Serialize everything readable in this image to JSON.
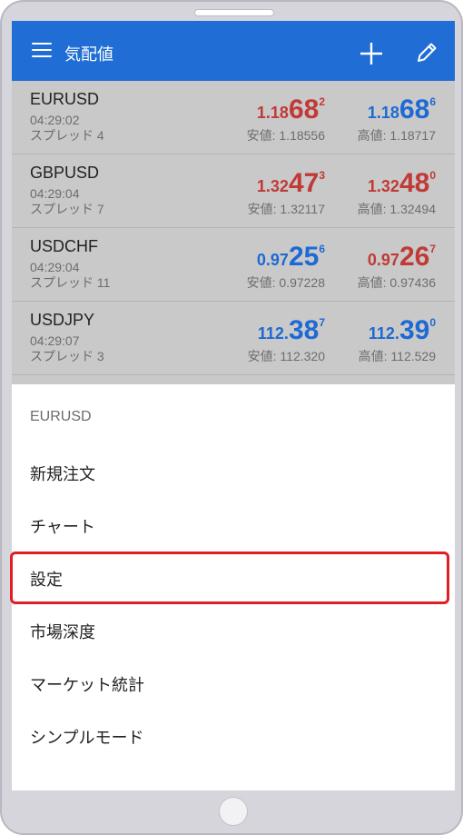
{
  "app": {
    "title": "気配値",
    "menu_icon": "hamburger-menu-icon",
    "add_icon": "plus-icon",
    "edit_icon": "pencil-icon",
    "header_color": "#1f6dd5"
  },
  "quotes": [
    {
      "symbol": "EURUSD",
      "time": "04:29:02",
      "spread": "スプレッド 4",
      "bid": {
        "small": "1.18",
        "big": "68",
        "sup": "2",
        "color": "red"
      },
      "ask": {
        "small": "1.18",
        "big": "68",
        "sup": "6",
        "color": "blue"
      },
      "low": "安値: 1.18556",
      "high": "高値: 1.18717"
    },
    {
      "symbol": "GBPUSD",
      "time": "04:29:04",
      "spread": "スプレッド 7",
      "bid": {
        "small": "1.32",
        "big": "47",
        "sup": "3",
        "color": "red"
      },
      "ask": {
        "small": "1.32",
        "big": "48",
        "sup": "0",
        "color": "red"
      },
      "low": "安値: 1.32117",
      "high": "高値: 1.32494"
    },
    {
      "symbol": "USDCHF",
      "time": "04:29:04",
      "spread": "スプレッド 11",
      "bid": {
        "small": "0.97",
        "big": "25",
        "sup": "6",
        "color": "blue"
      },
      "ask": {
        "small": "0.97",
        "big": "26",
        "sup": "7",
        "color": "red"
      },
      "low": "安値: 0.97228",
      "high": "高値: 0.97436"
    },
    {
      "symbol": "USDJPY",
      "time": "04:29:07",
      "spread": "スプレッド 3",
      "bid": {
        "small": "112.",
        "big": "38",
        "sup": "7",
        "color": "blue"
      },
      "ask": {
        "small": "112.",
        "big": "39",
        "sup": "0",
        "color": "blue"
      },
      "low": "安値: 112.320",
      "high": "高値: 112.529"
    }
  ],
  "context_menu": {
    "header": "EURUSD",
    "items": [
      "新規注文",
      "チャート",
      "設定",
      "市場深度",
      "マーケット統計",
      "シンプルモード"
    ],
    "highlighted_item": "設定",
    "highlight_color": "#e01e26"
  }
}
